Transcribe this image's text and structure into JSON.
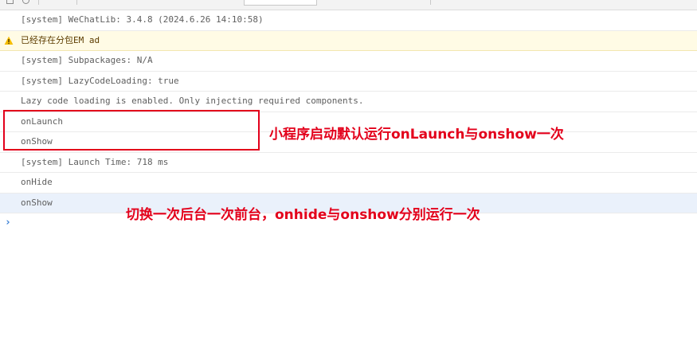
{
  "console": {
    "rows": [
      {
        "text": "[system] WeChatLib: 3.4.8 (2024.6.26 14:10:58)",
        "level": "log"
      },
      {
        "text": "已经存在分包EM ad",
        "level": "warning"
      },
      {
        "text": "[system] Subpackages: N/A",
        "level": "log"
      },
      {
        "text": "[system] LazyCodeLoading: true",
        "level": "log"
      },
      {
        "text": "Lazy code loading is enabled. Only injecting required components.",
        "level": "log"
      },
      {
        "text": "onLaunch",
        "level": "log"
      },
      {
        "text": "onShow",
        "level": "log"
      },
      {
        "text": "[system] Launch Time: 718 ms",
        "level": "log"
      },
      {
        "text": "onHide",
        "level": "log"
      },
      {
        "text": "onShow",
        "level": "log"
      }
    ],
    "prompt_symbol": "›"
  },
  "annotations": {
    "first": "小程序启动默认运行onLaunch与onshow一次",
    "second": "切换一次后台一次前台，onhide与onshow分别运行一次"
  },
  "colors": {
    "annotation_red": "#e3001b",
    "warning_bg": "#fffbe5",
    "prompt_blue": "#3a7fd5"
  },
  "icons": {
    "warning": "warning-icon",
    "prompt": "chevron-right-icon"
  }
}
